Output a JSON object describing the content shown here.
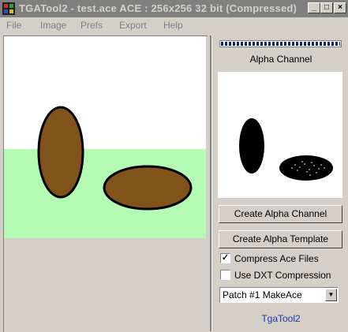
{
  "window": {
    "title": "TGATool2 - test.ace   ACE : 256x256 32 bit (Compressed)"
  },
  "titlebar": {
    "minimize": "_",
    "maximize": "□",
    "close": "×"
  },
  "menu": {
    "items": [
      "File",
      "Image",
      "Prefs",
      "Export",
      "Help"
    ]
  },
  "alpha": {
    "label": "Alpha Channel"
  },
  "buttons": {
    "create_alpha_channel": "Create Alpha Channel",
    "create_alpha_template": "Create Alpha Template"
  },
  "options": {
    "compress_ace": {
      "label": "Compress Ace Files",
      "checked": true,
      "mark": "✓"
    },
    "use_dxt": {
      "label": "Use DXT Compression",
      "checked": false
    }
  },
  "patch_select": {
    "value": "Patch #1 MakeAce",
    "arrow": "▼"
  },
  "footer": {
    "text": "TgaTool2"
  },
  "colors": {
    "ellipse_fill": "#7f531a",
    "ground": "#b4fbb4",
    "link": "#1a37a8",
    "title_bar": "#808080"
  }
}
